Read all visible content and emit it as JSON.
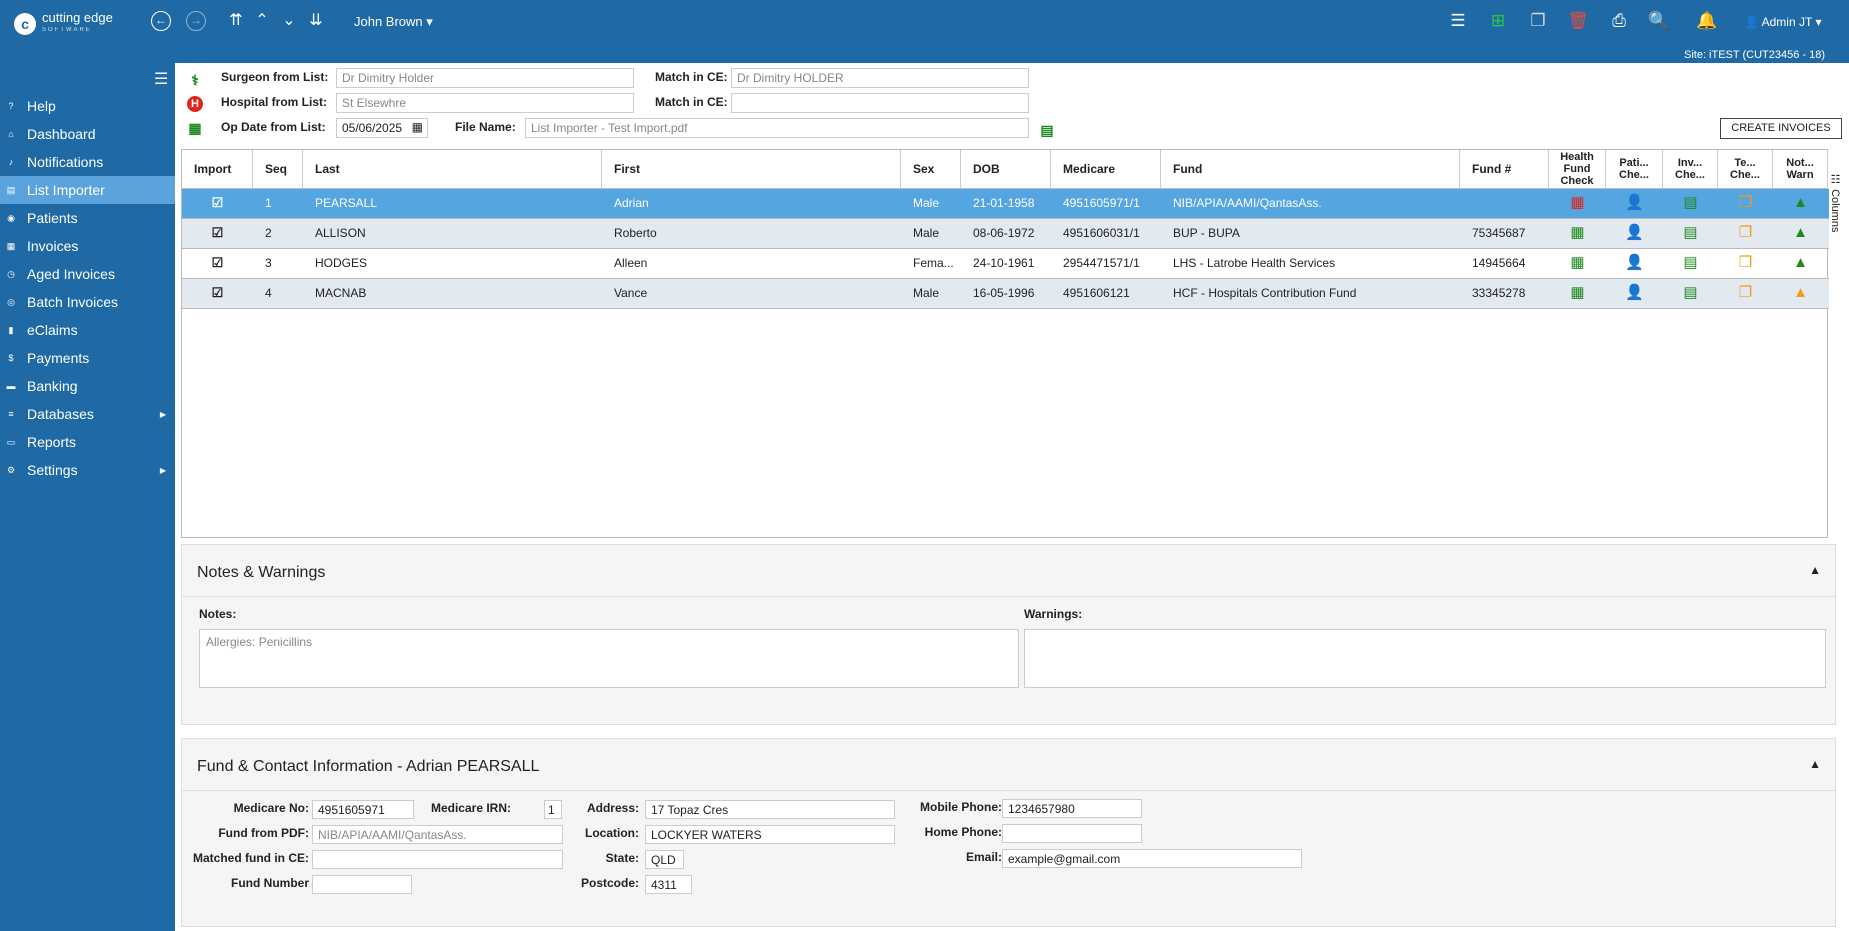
{
  "app": {
    "logo_text": "cutting edge",
    "logo_sub": "SOFTWARE",
    "logo_mark": "c"
  },
  "topbar": {
    "nav_icons": [
      {
        "name": "back-icon",
        "glyph": "←"
      },
      {
        "name": "forward-icon",
        "glyph": "→"
      },
      {
        "name": "first-record-icon",
        "glyph": "⇈"
      },
      {
        "name": "previous-record-icon",
        "glyph": "⌃"
      },
      {
        "name": "next-record-icon",
        "glyph": "⌄"
      },
      {
        "name": "last-record-icon",
        "glyph": "⇊"
      }
    ],
    "patient_selector": "John Brown",
    "tool_icons": [
      {
        "name": "list-icon",
        "glyph": "☰",
        "color": "#ffffff"
      },
      {
        "name": "add-icon",
        "glyph": "⊞",
        "color": "#2ecc40"
      },
      {
        "name": "copy-icon",
        "glyph": "❐",
        "color": "#cfd8e3"
      },
      {
        "name": "delete-icon",
        "glyph": "🗑",
        "color": "#e74c3c"
      },
      {
        "name": "print-icon",
        "glyph": "⎙",
        "color": "#ffffff"
      },
      {
        "name": "preview-icon",
        "glyph": "🔍",
        "color": "#ffffff"
      },
      {
        "name": "bell-icon",
        "glyph": "🔔",
        "color": "#2ecc40"
      }
    ],
    "admin_label": "Admin JT",
    "site": "Site: iTEST (CUT23456 - 18)"
  },
  "sidebar": {
    "items": [
      {
        "label": "Help",
        "icon": "?"
      },
      {
        "label": "Dashboard",
        "icon": "⌂"
      },
      {
        "label": "Notifications",
        "icon": "♪"
      },
      {
        "label": "List Importer",
        "icon": "▤"
      },
      {
        "label": "Patients",
        "icon": "◉"
      },
      {
        "label": "Invoices",
        "icon": "▦"
      },
      {
        "label": "Aged Invoices",
        "icon": "◷"
      },
      {
        "label": "Batch Invoices",
        "icon": "◎"
      },
      {
        "label": "eClaims",
        "icon": "▮"
      },
      {
        "label": "Payments",
        "icon": "$"
      },
      {
        "label": "Banking",
        "icon": "▬"
      },
      {
        "label": "Databases",
        "icon": "≡"
      },
      {
        "label": "Reports",
        "icon": "▭"
      },
      {
        "label": "Settings",
        "icon": "⚙"
      }
    ]
  },
  "header_fields": {
    "surgeon_label": "Surgeon from List:",
    "surgeon_value": "Dr Dimitry Holder",
    "match_label": "Match in CE:",
    "surgeon_match": "Dr Dimitry HOLDER",
    "hospital_label": "Hospital from List:",
    "hospital_value": "St Elsewhre",
    "hospital_match": "",
    "opdate_label": "Op Date from List:",
    "opdate_value": "05/06/2025",
    "file_label": "File Name:",
    "file_value": "List Importer - Test Import.pdf",
    "create_button": "CREATE INVOICES"
  },
  "grid": {
    "columns": [
      "Import",
      "Seq",
      "Last",
      "First",
      "Sex",
      "DOB",
      "Medicare",
      "Fund",
      "Fund #",
      "Health Fund Check",
      "Pati... Che...",
      "Inv... Che...",
      "Te... Che...",
      "Not... Warn"
    ],
    "columns_tab": "Columns",
    "rows": [
      {
        "seq": "1",
        "last": "PEARSALL",
        "first": "Adrian",
        "sex": "Male",
        "dob": "21-01-1958",
        "medicare": "4951605971/1",
        "fund": "NIB/APIA/AAMI/QantasAss.",
        "fund_no": "",
        "hf_color": "#e0241b",
        "warn_color": "#1e8a1e"
      },
      {
        "seq": "2",
        "last": "ALLISON",
        "first": "Roberto",
        "sex": "Male",
        "dob": "08-06-1972",
        "medicare": "4951606031/1",
        "fund": "BUP - BUPA",
        "fund_no": "75345687",
        "hf_color": "#1e8a1e",
        "warn_color": "#1e8a1e"
      },
      {
        "seq": "3",
        "last": "HODGES",
        "first": "Alleen",
        "sex": "Fema...",
        "dob": "24-10-1961",
        "medicare": "2954471571/1",
        "fund": "LHS - Latrobe Health Services",
        "fund_no": "14945664",
        "hf_color": "#1e8a1e",
        "warn_color": "#1e8a1e"
      },
      {
        "seq": "4",
        "last": "MACNAB",
        "first": "Vance",
        "sex": "Male",
        "dob": "16-05-1996",
        "medicare": "4951606121",
        "fund": "HCF - Hospitals Contribution Fund",
        "fund_no": "33345278",
        "hf_color": "#1e8a1e",
        "warn_color": "#f39c12"
      }
    ]
  },
  "notes": {
    "title": "Notes & Warnings",
    "notes_label": "Notes:",
    "notes_value": "Allergies: Penicillins",
    "warnings_label": "Warnings:",
    "warnings_value": ""
  },
  "contact": {
    "title": "Fund & Contact Information - Adrian PEARSALL",
    "medicare_no_label": "Medicare No:",
    "medicare_no": "4951605971",
    "irn_label": "Medicare IRN:",
    "irn": "1",
    "fund_pdf_label": "Fund from PDF:",
    "fund_pdf": "NIB/APIA/AAMI/QantasAss.",
    "matched_fund_label": "Matched fund in CE:",
    "matched_fund": "",
    "fund_number_label": "Fund Number",
    "fund_number": "",
    "address_label": "Address:",
    "address": "17 Topaz Cres",
    "location_label": "Location:",
    "location": "LOCKYER WATERS",
    "state_label": "State:",
    "state": "QLD",
    "postcode_label": "Postcode:",
    "postcode": "4311",
    "mobile_label": "Mobile Phone:",
    "mobile": "1234657980",
    "home_label": "Home Phone:",
    "home": "",
    "email_label": "Email:",
    "email": "example@gmail.com"
  }
}
